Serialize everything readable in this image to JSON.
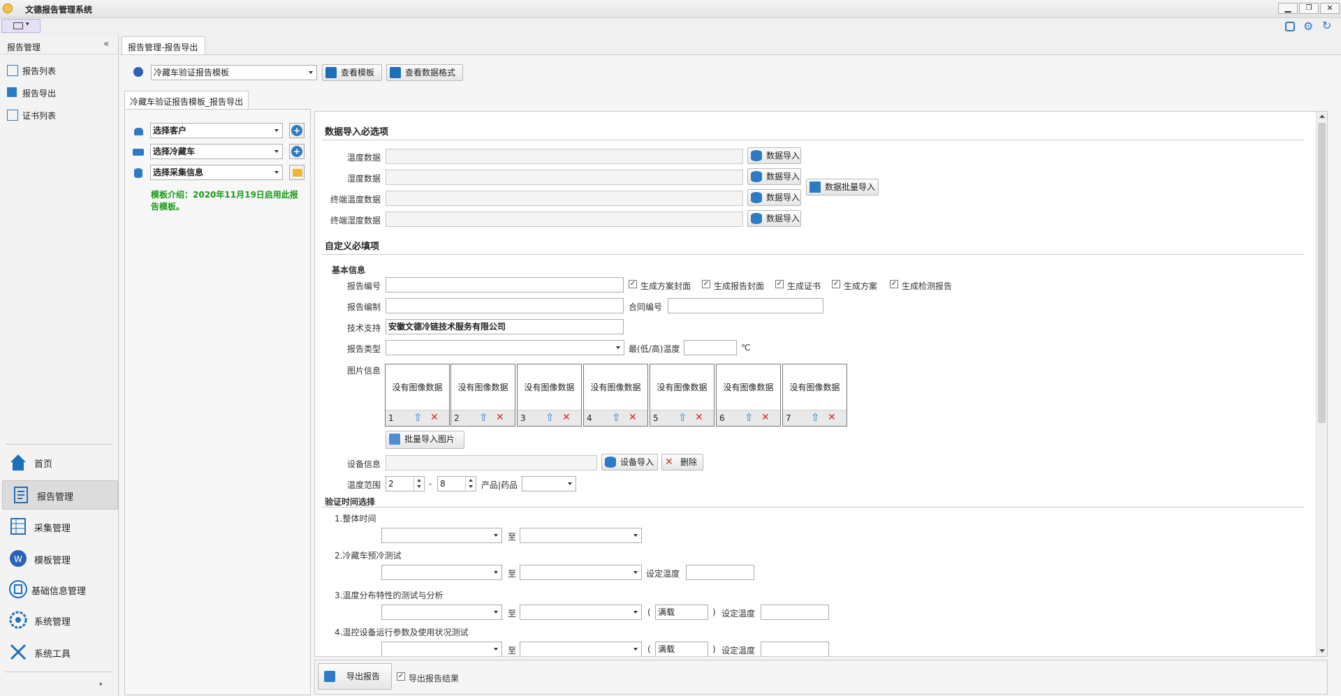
{
  "window": {
    "title": "文德报告管理系统"
  },
  "sidebar": {
    "title": "报告管理",
    "items": [
      {
        "label": "报告列表"
      },
      {
        "label": "报告导出"
      },
      {
        "label": "证书列表"
      }
    ],
    "nav": [
      {
        "label": "首页"
      },
      {
        "label": "报告管理"
      },
      {
        "label": "采集管理"
      },
      {
        "label": "模板管理"
      },
      {
        "label": "基础信息管理"
      },
      {
        "label": "系统管理"
      },
      {
        "label": "系统工具"
      }
    ]
  },
  "tabs": {
    "main": "报告管理-报告导出",
    "sub": "冷藏车验证报告模板_报告导出"
  },
  "toolbar": {
    "template": "冷藏车验证报告模板",
    "view_template": "查看模板",
    "view_format": "查看数据格式"
  },
  "left": {
    "customer": "选择客户",
    "vehicle": "选择冷藏车",
    "collect": "选择采集信息",
    "intro": "模板介绍：2020年11月19日启用此报告模板。"
  },
  "import": {
    "header": "数据导入必选项",
    "rows": [
      {
        "label": "温度数据",
        "button": "数据导入"
      },
      {
        "label": "湿度数据",
        "button": "数据导入"
      },
      {
        "label": "终端温度数据",
        "button": "数据导入"
      },
      {
        "label": "终端湿度数据",
        "button": "数据导入"
      }
    ],
    "batch": "数据批量导入"
  },
  "custom": {
    "header": "自定义必填项",
    "basic": "基本信息",
    "report_no": "报告编号",
    "checks": [
      {
        "label": "生成方案封面",
        "checked": true
      },
      {
        "label": "生成报告封面",
        "checked": true
      },
      {
        "label": "生成证书",
        "checked": true
      },
      {
        "label": "生成方案",
        "checked": true
      },
      {
        "label": "生成检测报告",
        "checked": true
      }
    ],
    "report_author": "报告编制",
    "contract_no": "合同编号",
    "tech_support": "技术支持",
    "tech_support_value": "安徽文德冷链技术服务有限公司",
    "report_type": "报告类型",
    "temp_minmax": "最(低/高)温度",
    "unit_c": "℃",
    "image_info": "图片信息",
    "no_image": "没有图像数据",
    "slots": [
      "1",
      "2",
      "3",
      "4",
      "5",
      "6",
      "7"
    ],
    "batch_images": "批量导入图片",
    "device_info": "设备信息",
    "device_import": "设备导入",
    "delete": "删除",
    "temp_range": "温度范围",
    "temp_low": "2",
    "dash": "-",
    "temp_high": "8",
    "product": "产品|药品"
  },
  "verify": {
    "header": "验证时间选择",
    "to": "至",
    "set_temp": "设定温度",
    "paren_open": "(",
    "paren_close": ")",
    "full_load": "满载",
    "sections": [
      "1.整体时间",
      "2.冷藏车预冷测试",
      "3.温度分布特性的测试与分析",
      "4.温控设备运行参数及使用状况测试"
    ]
  },
  "bottom": {
    "export": "导出报告",
    "export_result": "导出报告结果",
    "export_result_checked": true
  },
  "colors": {
    "accent": "#2d7bc4",
    "intro_green": "#1a9a1a",
    "delete_red": "#d12a2a"
  }
}
